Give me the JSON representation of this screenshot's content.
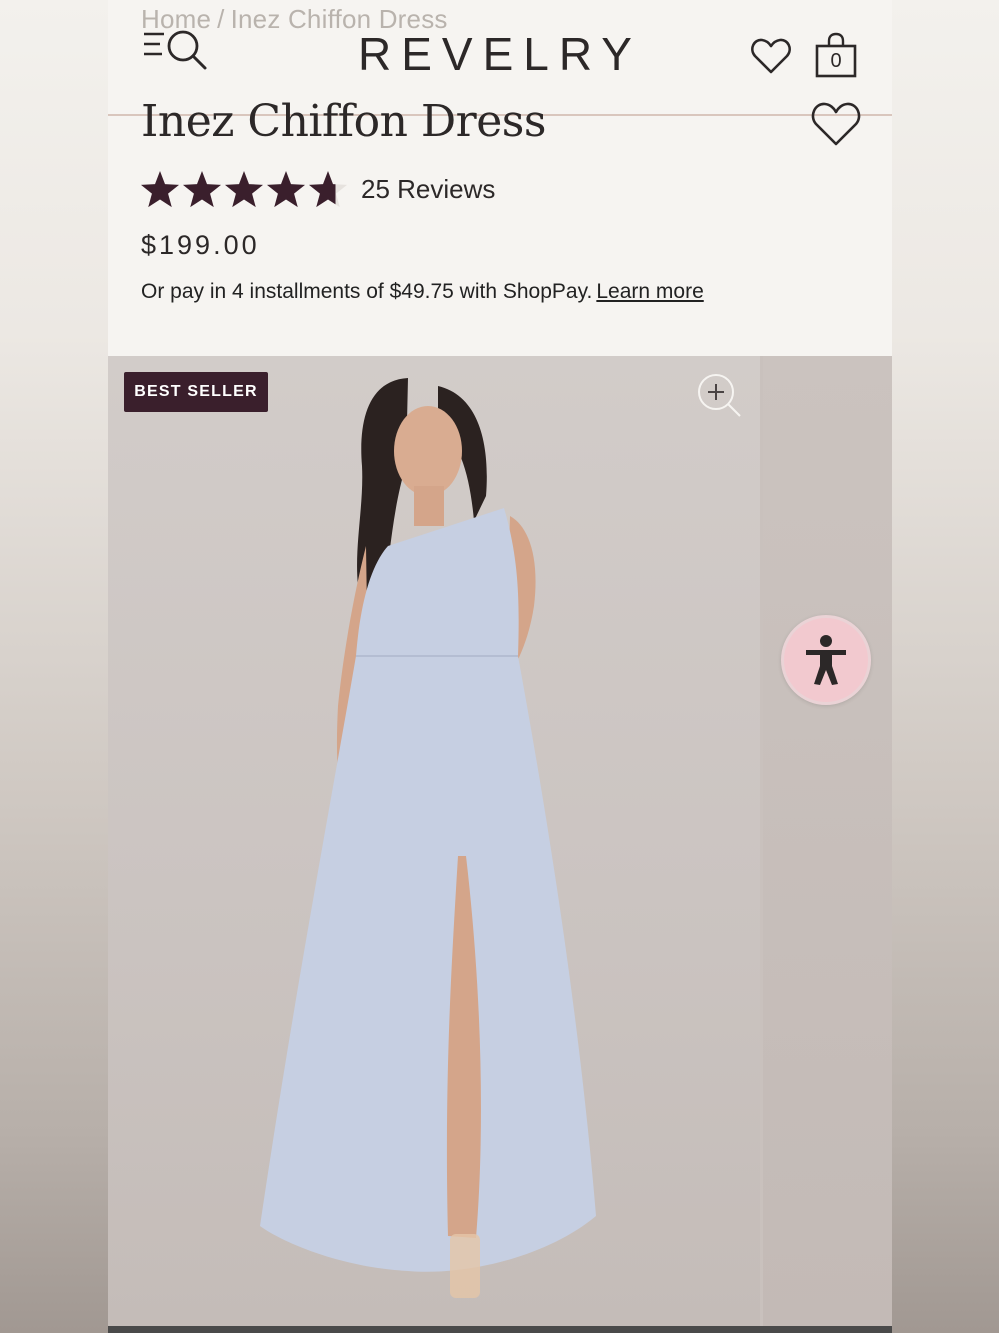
{
  "breadcrumb": {
    "home": "Home",
    "separator": "/",
    "current": "Inez Chiffon Dress"
  },
  "header": {
    "brand": "REVELRY",
    "menu_icon": "menu-icon",
    "search_icon": "search-icon",
    "wishlist_icon": "heart-icon",
    "bag_icon": "shopping-bag-icon",
    "bag_count": "0"
  },
  "product": {
    "title": "Inez Chiffon Dress",
    "rating": 4.7,
    "rating_max": 5,
    "reviews_label": "25 Reviews",
    "price": "$199.00",
    "installments_text": "Or pay in 4 installments of $49.75 with ShopPay.",
    "learn_more": "Learn more"
  },
  "gallery": {
    "badge": "BEST SELLER",
    "zoom_icon": "zoom-in-icon"
  },
  "accessibility": {
    "icon": "accessibility-icon"
  },
  "colors": {
    "badge_bg": "#3a1f2c",
    "star": "#3a1f2c",
    "a11y_bg": "#f2c9cf",
    "dress": "#c6cfe2"
  }
}
